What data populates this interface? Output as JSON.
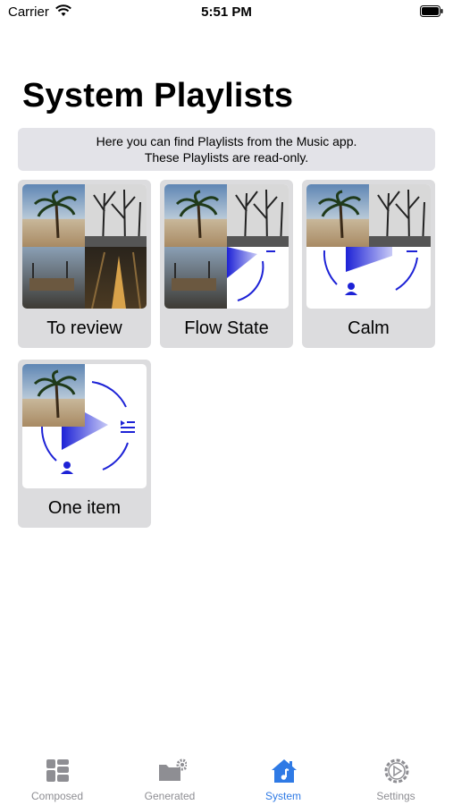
{
  "status_bar": {
    "carrier": "Carrier",
    "time": "5:51 PM"
  },
  "page": {
    "title": "System Playlists",
    "info_line1": "Here you can find Playlists from the Music app.",
    "info_line2": "These Playlists are read-only."
  },
  "playlists": [
    {
      "label": "To review"
    },
    {
      "label": "Flow State"
    },
    {
      "label": "Calm"
    },
    {
      "label": "One item"
    }
  ],
  "tabbar": {
    "tabs": [
      {
        "label": "Composed",
        "icon": "grid-icon"
      },
      {
        "label": "Generated",
        "icon": "folder-gear-icon"
      },
      {
        "label": "System",
        "icon": "house-music-icon",
        "active": true
      },
      {
        "label": "Settings",
        "icon": "gear-play-icon"
      }
    ],
    "active_color": "#2f7ae5",
    "inactive_color": "#8e8e93"
  }
}
